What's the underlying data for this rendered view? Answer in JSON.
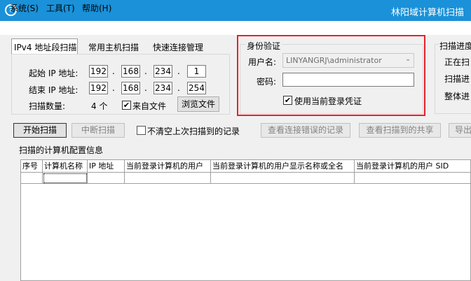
{
  "window": {
    "title": "林阳域计算机扫描"
  },
  "menu": [
    {
      "label": "系统(S)"
    },
    {
      "label": "工具(T)"
    },
    {
      "label": "帮助(H)"
    }
  ],
  "tabs": [
    {
      "label": "IPv4 地址段扫描"
    },
    {
      "label": "常用主机扫描"
    },
    {
      "label": "快速连接管理"
    }
  ],
  "ip_range": {
    "start_label": "起始 IP 地址:",
    "end_label": "结束 IP 地址:",
    "start": [
      "192",
      "168",
      "234",
      "1"
    ],
    "end": [
      "192",
      "168",
      "234",
      "254"
    ],
    "dot": ".",
    "count_label": "扫描数量:",
    "count_value": "4 个",
    "from_file_label": "来自文件",
    "from_file_checked": "✔",
    "browse_label": "浏览文件"
  },
  "auth": {
    "group_label": "身份验证",
    "username_label": "用户名:",
    "username_value": "LINYANGRJ\\administrator",
    "password_label": "密码:",
    "use_current_label": "使用当前登录凭证",
    "use_current_checked": "✔"
  },
  "progress": {
    "group_label": "扫描进度",
    "line1": "正在扫",
    "line2": "扫描进",
    "line3": "整体进"
  },
  "actions": {
    "start": "开始扫描",
    "stop": "中断扫描",
    "keep_label": "不清空上次扫描到的记录",
    "view_errors": "查看连接错误的记录",
    "view_shares": "查看扫描到的共享",
    "export": "导出"
  },
  "results": {
    "group_label": "扫描的计算机配置信息",
    "columns": [
      "序号",
      "计算机名称",
      "IP 地址",
      "当前登录计算机的用户",
      "当前登录计算机的用户显示名称或全名",
      "当前登录计算机的用户 SID"
    ]
  },
  "colors": {
    "titlebar": "#1a91d8",
    "highlight": "#e8202a"
  }
}
